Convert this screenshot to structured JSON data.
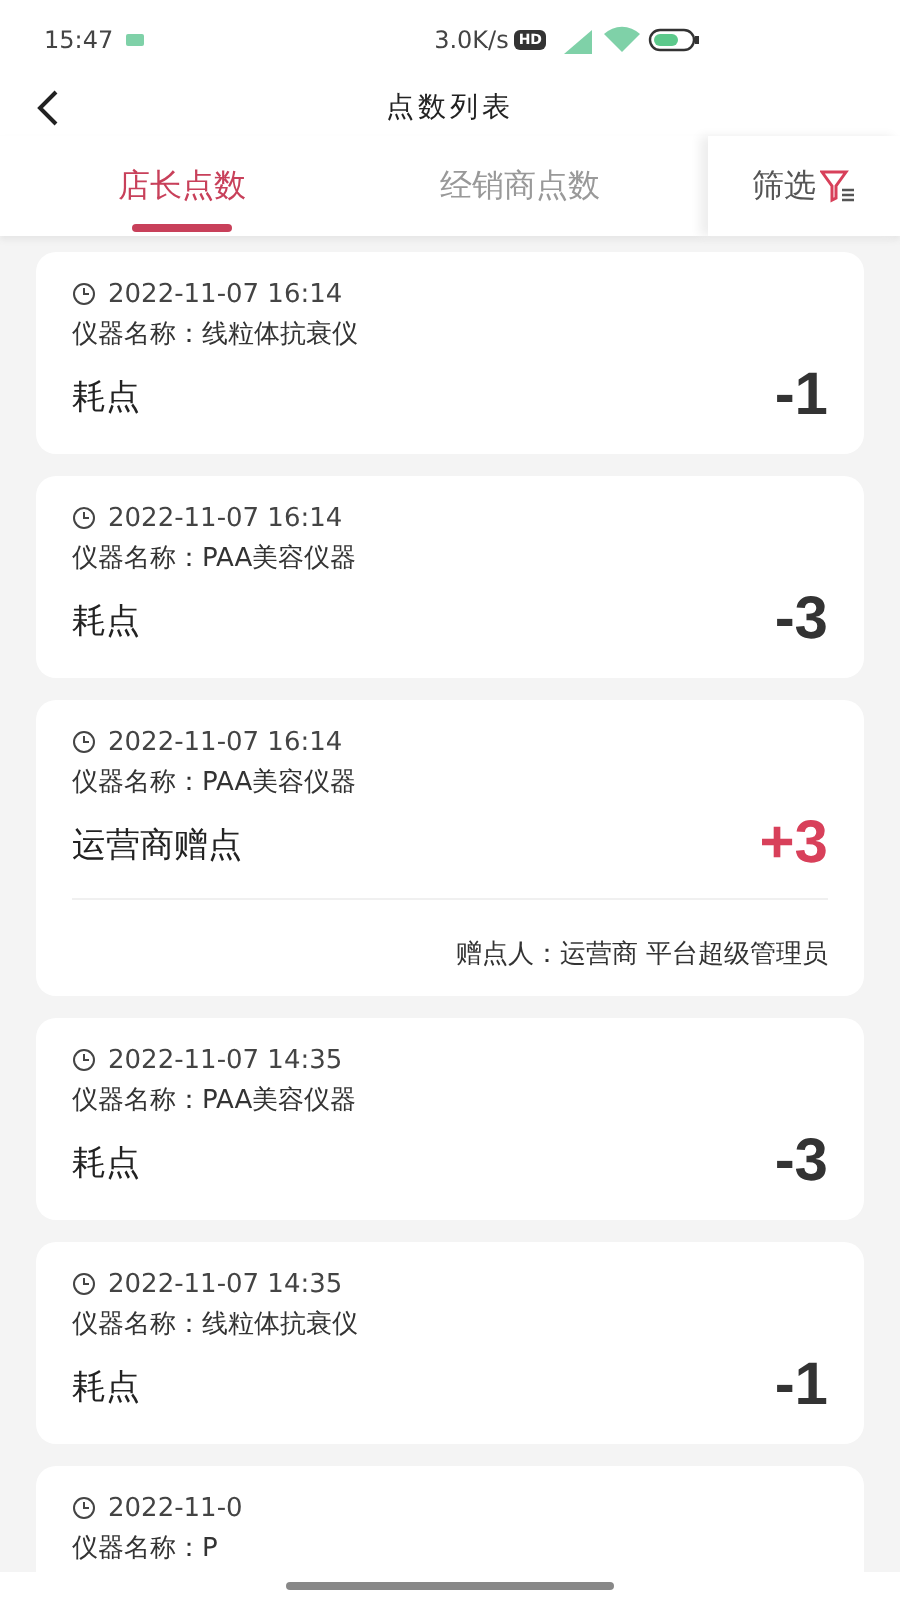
{
  "status_bar": {
    "time": "15:47",
    "speed": "3.0K/s",
    "hd_badge": "HD"
  },
  "header": {
    "title": "点数列表"
  },
  "tabs": [
    {
      "label": "店长点数",
      "selected": true
    },
    {
      "label": "经销商点数",
      "selected": false
    }
  ],
  "filter": {
    "label": "筛选"
  },
  "records": [
    {
      "time": "2022-11-07 16:14",
      "device": "仪器名称：线粒体抗衰仪",
      "action": "耗点",
      "points": "-1",
      "kind": "debit"
    },
    {
      "time": "2022-11-07 16:14",
      "device": "仪器名称：PAA美容仪器",
      "action": "耗点",
      "points": "-3",
      "kind": "debit"
    },
    {
      "time": "2022-11-07 16:14",
      "device": "仪器名称：PAA美容仪器",
      "action": "运营商赠点",
      "points": "+3",
      "kind": "credit",
      "giver": "赠点人：运营商 平台超级管理员"
    },
    {
      "time": "2022-11-07 14:35",
      "device": "仪器名称：PAA美容仪器",
      "action": "耗点",
      "points": "-3",
      "kind": "debit"
    },
    {
      "time": "2022-11-07 14:35",
      "device": "仪器名称：线粒体抗衰仪",
      "action": "耗点",
      "points": "-1",
      "kind": "debit"
    },
    {
      "time": "2022-11-0",
      "device": "仪器名称：P",
      "kind": "partial"
    }
  ]
}
